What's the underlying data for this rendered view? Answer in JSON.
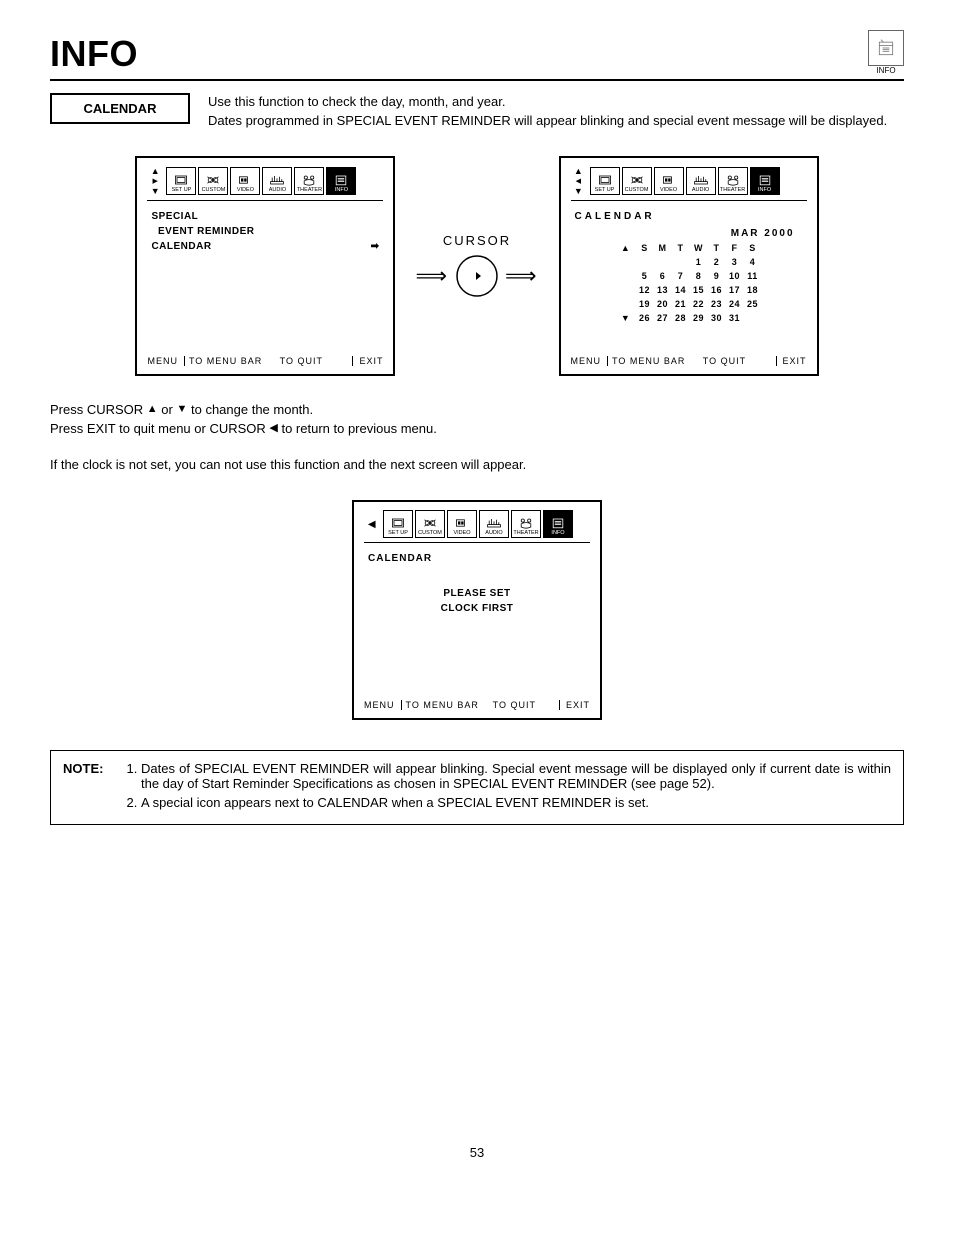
{
  "page": {
    "title": "INFO",
    "corner_label": "INFO",
    "page_number": "53"
  },
  "section": {
    "label": "CALENDAR",
    "description": "Use this function to check the day, month, and year.\nDates programmed in SPECIAL EVENT REMINDER will appear blinking and special event message will be displayed."
  },
  "menubar_tabs": [
    "SET UP",
    "CUSTOM",
    "VIDEO",
    "AUDIO",
    "THEATER",
    "INFO"
  ],
  "osd_left": {
    "items": [
      "SPECIAL",
      "  EVENT REMINDER",
      "CALENDAR"
    ],
    "footer": {
      "menu": "MENU",
      "center": "TO MENU BAR     TO QUIT",
      "exit": "EXIT"
    }
  },
  "cursor_label": "CURSOR",
  "osd_right": {
    "heading": "CALENDAR",
    "month": "MAR 2000",
    "dow": [
      "S",
      "M",
      "T",
      "W",
      "T",
      "F",
      "S"
    ],
    "weeks": [
      [
        "",
        "",
        "",
        "1",
        "2",
        "3",
        "4"
      ],
      [
        "5",
        "6",
        "7",
        "8",
        "9",
        "10",
        "11"
      ],
      [
        "12",
        "13",
        "14",
        "15",
        "16",
        "17",
        "18"
      ],
      [
        "19",
        "20",
        "21",
        "22",
        "23",
        "24",
        "25"
      ],
      [
        "26",
        "27",
        "28",
        "29",
        "30",
        "31",
        ""
      ]
    ],
    "footer": {
      "menu": "MENU",
      "center": "TO MENU BAR     TO QUIT",
      "exit": "EXIT"
    }
  },
  "instructions": {
    "line1_pre": "Press CURSOR ",
    "line1_mid": " or ",
    "line1_post": " to change the month.",
    "line2_pre": "Press EXIT to quit menu or CURSOR ",
    "line2_post": " to return to previous menu.",
    "line3": "If the clock is not set, you can not use this function and the next screen will appear."
  },
  "osd_clock": {
    "heading": "CALENDAR",
    "msg1": "PLEASE SET",
    "msg2": "CLOCK FIRST",
    "footer": {
      "menu": "MENU",
      "center": "TO MENU BAR    TO QUIT",
      "exit": "EXIT"
    }
  },
  "note": {
    "label": "NOTE:",
    "items": [
      "Dates of SPECIAL EVENT REMINDER will appear blinking.  Special event message will be displayed only if current date is within the day of Start Reminder Specifications as chosen in SPECIAL EVENT REMINDER (see page 52).",
      "A special icon appears next to  CALENDAR  when a SPECIAL EVENT REMINDER is set."
    ]
  }
}
